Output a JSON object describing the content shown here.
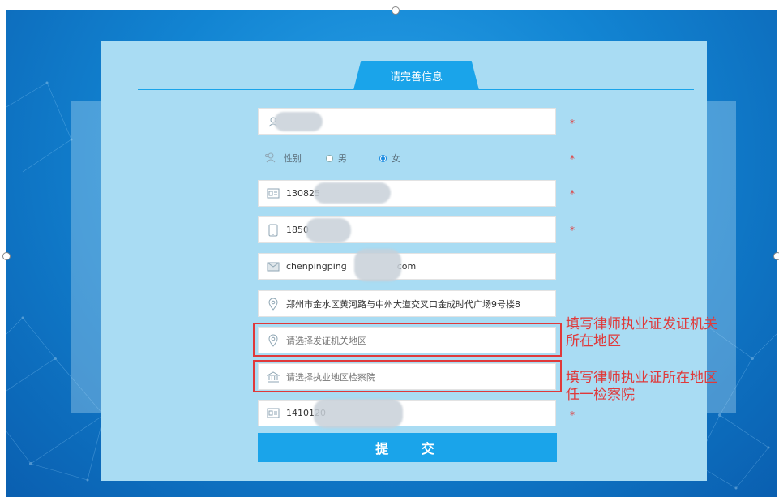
{
  "tab_title": "请完善信息",
  "name_field": {
    "value": ""
  },
  "gender": {
    "label": "性别",
    "options": [
      "男",
      "女"
    ],
    "selected": "女"
  },
  "id_card_field": {
    "value": "130825"
  },
  "phone_field": {
    "value": "1850"
  },
  "email_field": {
    "value_prefix": "chenpingping",
    "value_suffix": "com"
  },
  "address_field": {
    "value": "郑州市金水区黄河路与中州大道交叉口金成时代广场9号楼8"
  },
  "issuing_region_field": {
    "placeholder": "请选择发证机关地区"
  },
  "procuratorate_field": {
    "placeholder": "请选择执业地区检察院"
  },
  "license_field": {
    "value": "1410120"
  },
  "required_mark": "*",
  "submit_label": "提 交",
  "annotations": {
    "issuing_note_line1": "填写律师执业证发证机关",
    "issuing_note_line2": "所在地区",
    "procuratorate_note_line1": "填写律师执业证所在地区",
    "procuratorate_note_line2": "任一检察院"
  },
  "colors": {
    "accent": "#1aa4ea",
    "highlight": "#e0393a",
    "panel": "#a9dcf3"
  },
  "icons": [
    "user-icon",
    "gender-icon",
    "id-card-icon",
    "phone-icon",
    "mail-icon",
    "location-icon",
    "bank-icon",
    "card-icon"
  ]
}
